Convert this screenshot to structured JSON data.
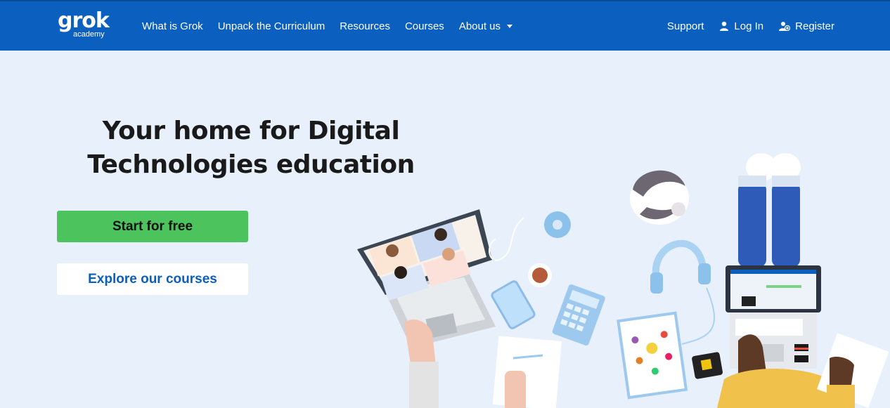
{
  "brand": {
    "name": "grok",
    "sub": "academy"
  },
  "nav": {
    "links": [
      {
        "label": "What is Grok"
      },
      {
        "label": "Unpack the Curriculum"
      },
      {
        "label": "Resources"
      },
      {
        "label": "Courses"
      },
      {
        "label": "About us"
      }
    ],
    "support": "Support",
    "login": "Log In",
    "register": "Register"
  },
  "hero": {
    "title_line1": "Your home for Digital",
    "title_line2": "Technologies education",
    "primary_button": "Start for free",
    "secondary_button": "Explore our courses"
  },
  "colors": {
    "navbar": "#0a5fbf",
    "background": "#e8f0fb",
    "primary_button": "#4cc35c",
    "link_blue": "#0a5fbf"
  }
}
